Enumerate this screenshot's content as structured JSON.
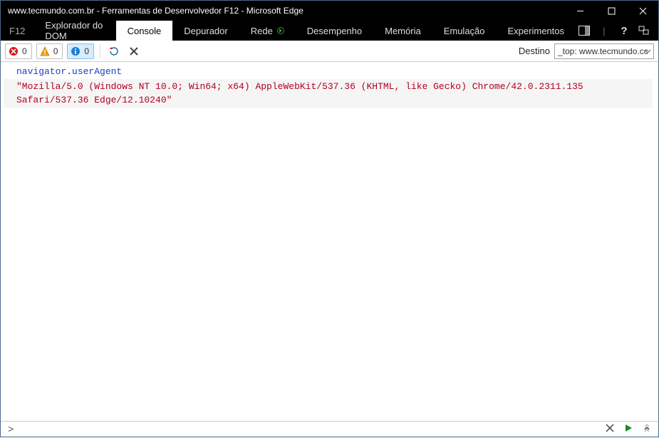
{
  "titlebar": {
    "text": "www.tecmundo.com.br - Ferramentas de Desenvolvedor F12 - Microsoft Edge"
  },
  "menubar": {
    "f12": "F12",
    "tabs": {
      "dom": "Explorador do DOM",
      "console": "Console",
      "depurador": "Depurador",
      "rede": "Rede",
      "desempenho": "Desempenho",
      "memoria": "Memória",
      "emulacao": "Emulação",
      "experimentos": "Experimentos"
    },
    "help": "?"
  },
  "toolbar": {
    "errors": "0",
    "warnings": "0",
    "info": "0",
    "destino_label": "Destino",
    "destino_value": "_top: www.tecmundo.cc"
  },
  "console": {
    "cmd": "navigator.userAgent",
    "output": "\"Mozilla/5.0 (Windows NT 10.0; Win64; x64) AppleWebKit/537.36 (KHTML, like Gecko) Chrome/42.0.2311.135 Safari/537.36 Edge/12.10240\""
  },
  "footer": {
    "prompt": ">"
  }
}
